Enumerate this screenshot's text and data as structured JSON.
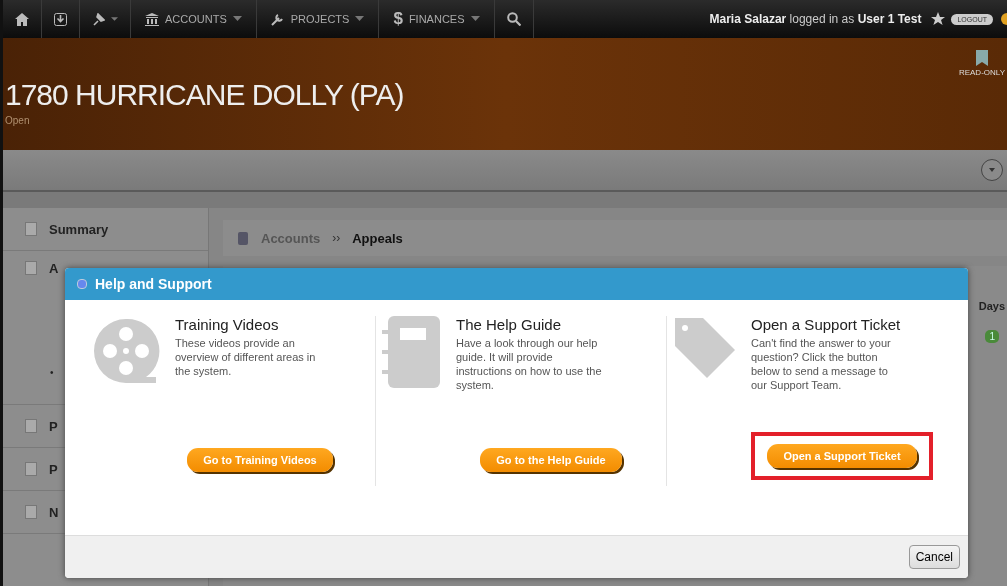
{
  "nav": {
    "menus": [
      {
        "label": "ACCOUNTS"
      },
      {
        "label": "PROJECTS"
      },
      {
        "label": "FINANCES",
        "icon_text": "$"
      }
    ],
    "user_line": "**Maria Salazar** logged in as **User 1 Test**",
    "logout": "LOGOUT"
  },
  "header": {
    "title": "1780 HURRICANE DOLLY (PA)",
    "status": "Open",
    "badge": "READ-ONLY"
  },
  "sidebar": {
    "items": [
      {
        "kind": "item",
        "label": "Summary"
      },
      {
        "kind": "item",
        "label": "A"
      },
      {
        "kind": "bullet",
        "label": "•"
      },
      {
        "kind": "item",
        "label": "P"
      },
      {
        "kind": "item",
        "label": "P"
      },
      {
        "kind": "item",
        "label": "N"
      }
    ]
  },
  "breadcrumb_separator": "››",
  "breadcrumb": [
    {
      "label": "Accounts",
      "current": false
    },
    {
      "label": "Appeals",
      "current": true
    }
  ],
  "table": {
    "column": "Days",
    "badge": "1"
  },
  "modal": {
    "title": "Help and Support",
    "cards": [
      {
        "title": "Training Videos",
        "text": "These videos provide an overview of different areas in the system.",
        "button": "Go to Training Videos",
        "highlighted": false
      },
      {
        "title": "The Help Guide",
        "text": "Have a look through our help guide. It will provide instructions on how to use the system.",
        "button": "Go to the Help Guide",
        "highlighted": false
      },
      {
        "title": "Open a Support Ticket",
        "text": "Can't find the answer to your question? Click the button below to send a message to our Support Team.",
        "button": "Open a Support Ticket",
        "highlighted": true
      }
    ],
    "cancel": "Cancel"
  }
}
